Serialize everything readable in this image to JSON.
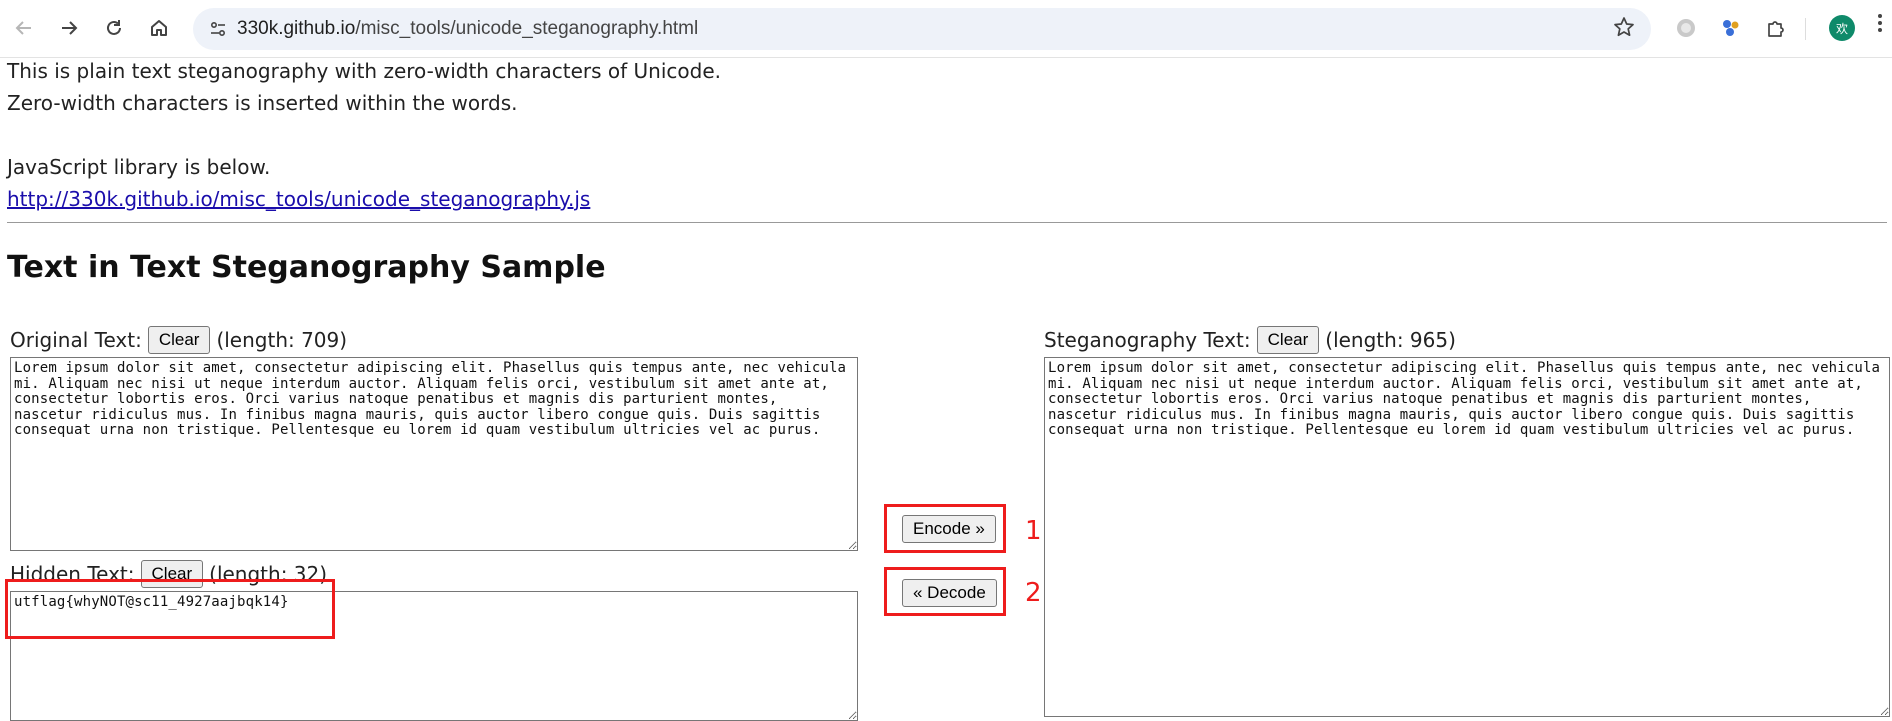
{
  "browser": {
    "url_host": "330k.github.io",
    "url_path": "/misc_tools/unicode_steganography.html",
    "avatar_text": "欢"
  },
  "intro": {
    "line1": "This is plain text steganography with zero-width characters of Unicode.",
    "line2": "Zero-width characters is inserted within the words.",
    "line3": "JavaScript library is below.",
    "link": "http://330k.github.io/misc_tools/unicode_steganography.js"
  },
  "section_title": "Text in Text Steganography Sample",
  "original": {
    "label": "Original Text:",
    "clear_label": "Clear",
    "length_text": "(length: 709)",
    "value": "Lorem ipsum dolor sit amet, consectetur adipiscing elit. Phasellus quis tempus ante, nec vehicula mi. Aliquam nec nisi ut neque interdum auctor. Aliquam felis orci, vestibulum sit amet ante at, consectetur lobortis eros. Orci varius natoque penatibus et magnis dis parturient montes, nascetur ridiculus mus. In finibus magna mauris, quis auctor libero congue quis. Duis sagittis consequat urna non tristique. Pellentesque eu lorem id quam vestibulum ultricies vel ac purus."
  },
  "hidden": {
    "label": "Hidden Text:",
    "clear_label": "Clear",
    "length_text": "(length: 32)",
    "value": "utflag{whyNOT@sc11_4927aajbqk14}"
  },
  "stego": {
    "label": "Steganography Text:",
    "clear_label": "Clear",
    "length_text": "(length: 965)",
    "value": "Lorem ipsum dolor sit amet, consectetur adipiscing elit. Phasellus quis tempus ante, nec vehicula mi. Aliquam nec nisi ut neque interdum auctor. Aliquam felis orci, vestibulum sit amet ante at, consectetur lobortis eros. Orci varius natoque penatibus et magnis dis parturient montes, nascetur ridiculus mus. In finibus magna mauris, quis auctor libero congue quis. Duis sagittis consequat urna non tristique. Pellentesque eu lorem id quam vestibulum ultricies vel ac purus."
  },
  "actions": {
    "encode_label": "Encode »",
    "decode_label": "« Decode"
  },
  "annotations": {
    "step1": "1",
    "step2": "2",
    "highlight_color": "#ee1c1c"
  },
  "icons": {
    "back": "arrow-left-icon",
    "forward": "arrow-right-icon",
    "reload": "reload-icon",
    "home": "home-icon",
    "site_info": "tune-icon",
    "bookmark": "star-icon",
    "extensions": "puzzle-icon",
    "menu": "more-vertical-icon"
  }
}
